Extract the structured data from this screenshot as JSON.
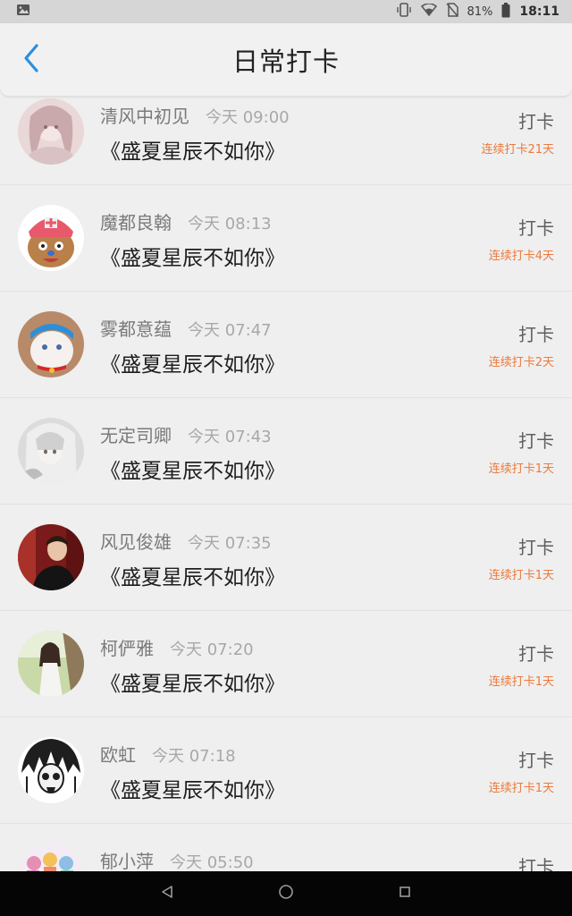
{
  "status_bar": {
    "battery_percent": "81%",
    "time": "18:11"
  },
  "header": {
    "title": "日常打卡"
  },
  "entries": [
    {
      "name": "清风中初见",
      "time": "今天 09:00",
      "book": "《盛夏星辰不如你》",
      "action": "打卡",
      "streak": "连续打卡21天"
    },
    {
      "name": "魔都良翰",
      "time": "今天 08:13",
      "book": "《盛夏星辰不如你》",
      "action": "打卡",
      "streak": "连续打卡4天"
    },
    {
      "name": "雾都意蕴",
      "time": "今天 07:47",
      "book": "《盛夏星辰不如你》",
      "action": "打卡",
      "streak": "连续打卡2天"
    },
    {
      "name": "无定司卿",
      "time": "今天 07:43",
      "book": "《盛夏星辰不如你》",
      "action": "打卡",
      "streak": "连续打卡1天"
    },
    {
      "name": "风见俊雄",
      "time": "今天 07:35",
      "book": "《盛夏星辰不如你》",
      "action": "打卡",
      "streak": "连续打卡1天"
    },
    {
      "name": "柯俨雅",
      "time": "今天 07:20",
      "book": "《盛夏星辰不如你》",
      "action": "打卡",
      "streak": "连续打卡1天"
    },
    {
      "name": "欧虹",
      "time": "今天 07:18",
      "book": "《盛夏星辰不如你》",
      "action": "打卡",
      "streak": "连续打卡1天"
    },
    {
      "name": "郁小萍",
      "time": "今天 05:50",
      "book": "",
      "action": "打卡",
      "streak": ""
    }
  ],
  "colors": {
    "accent_back": "#2a8fe0",
    "streak": "#ec7a3c"
  }
}
